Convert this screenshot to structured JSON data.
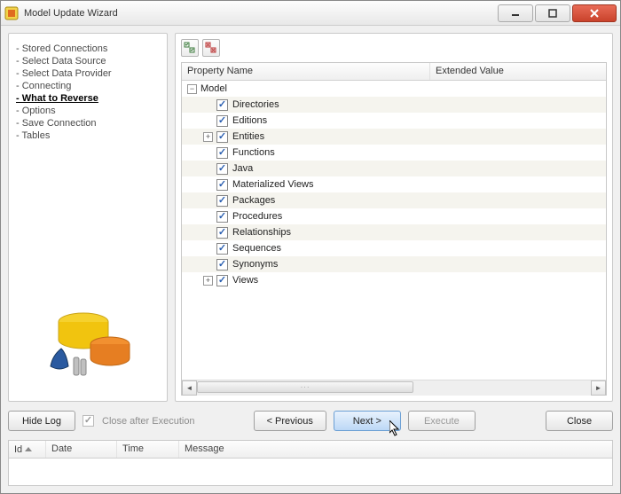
{
  "title": "Model Update Wizard",
  "sidebar": {
    "steps": [
      {
        "label": "Stored Connections",
        "current": false
      },
      {
        "label": "Select Data Source",
        "current": false
      },
      {
        "label": "Select Data Provider",
        "current": false
      },
      {
        "label": "Connecting",
        "current": false
      },
      {
        "label": "What to Reverse",
        "current": true
      },
      {
        "label": "Options",
        "current": false
      },
      {
        "label": "Save Connection",
        "current": false
      },
      {
        "label": "Tables",
        "current": false
      }
    ]
  },
  "tree": {
    "col1": "Property Name",
    "col2": "Extended Value",
    "root": {
      "label": "Model",
      "toggle": "−"
    },
    "items": [
      {
        "label": "Directories",
        "checked": true,
        "alt": true,
        "toggle": ""
      },
      {
        "label": "Editions",
        "checked": true,
        "alt": false,
        "toggle": ""
      },
      {
        "label": "Entities",
        "checked": true,
        "alt": true,
        "toggle": "+"
      },
      {
        "label": "Functions",
        "checked": true,
        "alt": false,
        "toggle": ""
      },
      {
        "label": "Java",
        "checked": true,
        "alt": true,
        "toggle": ""
      },
      {
        "label": "Materialized Views",
        "checked": true,
        "alt": false,
        "toggle": ""
      },
      {
        "label": "Packages",
        "checked": true,
        "alt": true,
        "toggle": ""
      },
      {
        "label": "Procedures",
        "checked": true,
        "alt": false,
        "toggle": ""
      },
      {
        "label": "Relationships",
        "checked": true,
        "alt": true,
        "toggle": ""
      },
      {
        "label": "Sequences",
        "checked": true,
        "alt": false,
        "toggle": ""
      },
      {
        "label": "Synonyms",
        "checked": true,
        "alt": true,
        "toggle": ""
      },
      {
        "label": "Views",
        "checked": true,
        "alt": false,
        "toggle": "+"
      }
    ]
  },
  "buttons": {
    "hideLog": "Hide Log",
    "closeAfter": "Close after Execution",
    "prev": "< Previous",
    "next": "Next >",
    "execute": "Execute",
    "close": "Close"
  },
  "log": {
    "id": "Id",
    "date": "Date",
    "time": "Time",
    "message": "Message"
  }
}
